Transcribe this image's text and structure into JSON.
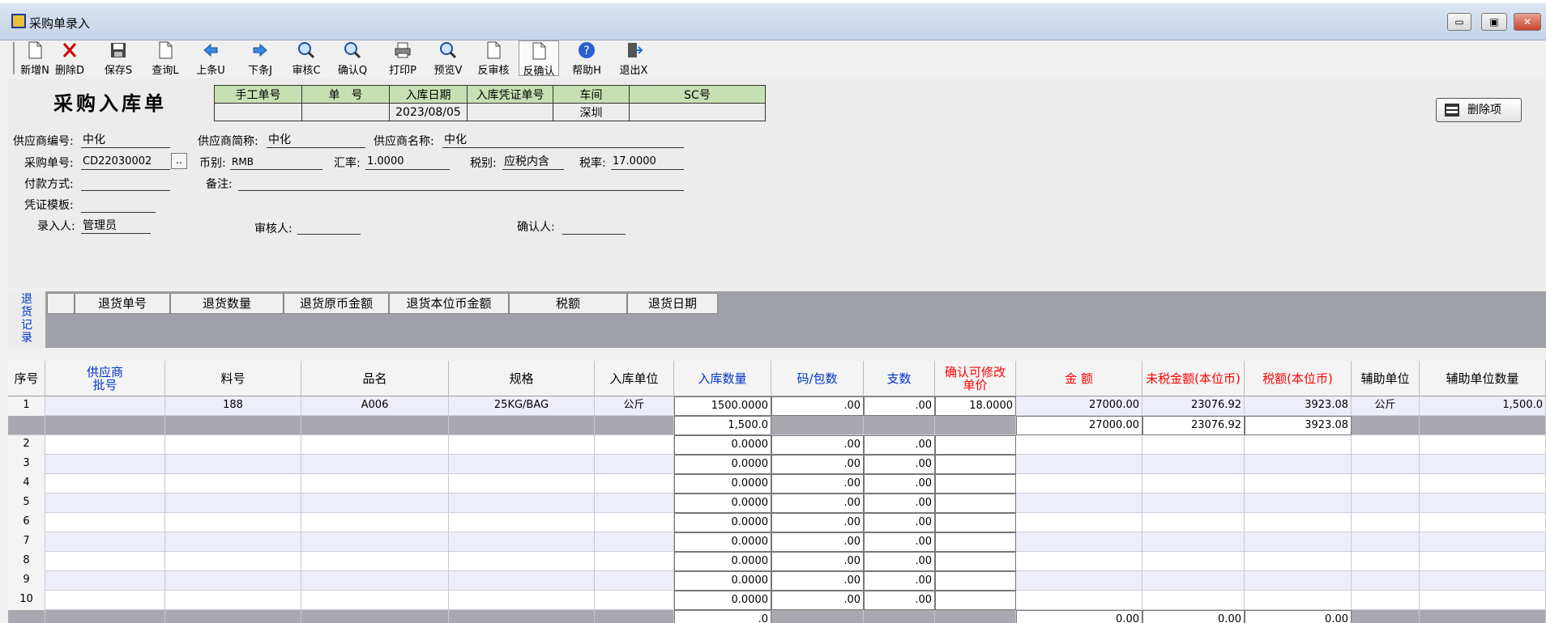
{
  "window": {
    "title": "采购单录入",
    "min": "▭",
    "restore": "▣",
    "close": "✕"
  },
  "toolbar": [
    {
      "label": "新增N",
      "icon": "new-doc-icon"
    },
    {
      "label": "删除D",
      "icon": "delete-x-icon"
    },
    {
      "label": "保存S",
      "icon": "save-disk-icon"
    },
    {
      "label": "查询L",
      "icon": "query-doc-icon"
    },
    {
      "label": "上条U",
      "icon": "arrow-left-icon"
    },
    {
      "label": "下条J",
      "icon": "arrow-right-icon"
    },
    {
      "label": "审核C",
      "icon": "magnifier-icon"
    },
    {
      "label": "确认Q",
      "icon": "magnifier-icon"
    },
    {
      "label": "打印P",
      "icon": "printer-icon"
    },
    {
      "label": "预览V",
      "icon": "preview-magnifier-icon"
    },
    {
      "label": "反审核",
      "icon": "reverse-audit-icon"
    },
    {
      "label": "反确认",
      "icon": "reverse-confirm-icon"
    },
    {
      "label": "帮助H",
      "icon": "help-icon"
    },
    {
      "label": "退出X",
      "icon": "exit-door-icon"
    }
  ],
  "form": {
    "title": "采购入库单",
    "header_cols": [
      "手工单号",
      "单　号",
      "入库日期",
      "入库凭证单号",
      "车间",
      "SC号"
    ],
    "header_vals": [
      "",
      "",
      "2023/08/05",
      "",
      "深圳",
      ""
    ],
    "supplier_code_label": "供应商编号:",
    "supplier_code": "中化",
    "supplier_short_label": "供应商简称:",
    "supplier_short": "中化",
    "supplier_name_label": "供应商名称:",
    "supplier_name": "中化",
    "po_label": "采购单号:",
    "po": "CD22030002",
    "po_btn": "..",
    "currency_label": "币别:",
    "currency": "RMB",
    "rate_label": "汇率:",
    "rate": "1.0000",
    "tax_type_label": "税别:",
    "tax_type": "应税内含",
    "tax_rate_label": "税率:",
    "tax_rate": "17.0000",
    "payment_label": "付款方式:",
    "payment": "",
    "remark_label": "备注:",
    "remark": "",
    "voucher_label": "凭证模板:",
    "voucher": "",
    "entered_by_label": "录入人:",
    "entered_by": "管理员",
    "auditor_label": "审核人:",
    "auditor": "",
    "confirmer_label": "确认人:",
    "confirmer": "",
    "delete_item_btn": "删除项"
  },
  "returns": {
    "side_label": [
      "退",
      "货",
      "记",
      "录"
    ],
    "columns": [
      "退货单号",
      "退货数量",
      "退货原币金额",
      "退货本位币金额",
      "税额",
      "退货日期"
    ]
  },
  "grid": {
    "columns": [
      "序号",
      "供应商\n批号",
      "料号",
      "品名",
      "规格",
      "入库单位",
      "入库数量",
      "码/包数",
      "支数",
      "确认可修改\n单价",
      "金 额",
      "未税金额(本位币)",
      "税额(本位币)",
      "辅助单位",
      "辅助单位数量"
    ],
    "column_colors": [
      "#000000",
      "#0033cc",
      "#000000",
      "#000000",
      "#000000",
      "#000000",
      "#0033cc",
      "#0033cc",
      "#0033cc",
      "#ff0000",
      "#ff0000",
      "#ff0000",
      "#ff0000",
      "#000000",
      "#000000"
    ],
    "row1": {
      "no": "1",
      "batch": "",
      "part": "188",
      "name": "A006",
      "spec": "25KG/BAG",
      "unit": "公斤",
      "qty": "1500.0000",
      "pack": ".00",
      "count": ".00",
      "price": "18.0000",
      "amount": "27000.00",
      "net": "23076.92",
      "tax": "3923.08",
      "aux_unit": "公斤",
      "aux_qty": "1,500.0"
    },
    "sub1": {
      "qty": "1,500.0",
      "amount": "27000.00",
      "net": "23076.92",
      "tax": "3923.08"
    },
    "empty_rows": [
      {
        "no": "2",
        "qty": "0.0000",
        "pack": ".00",
        "count": ".00"
      },
      {
        "no": "3",
        "qty": "0.0000",
        "pack": ".00",
        "count": ".00"
      },
      {
        "no": "4",
        "qty": "0.0000",
        "pack": ".00",
        "count": ".00"
      },
      {
        "no": "5",
        "qty": "0.0000",
        "pack": ".00",
        "count": ".00"
      },
      {
        "no": "6",
        "qty": "0.0000",
        "pack": ".00",
        "count": ".00"
      },
      {
        "no": "7",
        "qty": "0.0000",
        "pack": ".00",
        "count": ".00"
      },
      {
        "no": "8",
        "qty": "0.0000",
        "pack": ".00",
        "count": ".00"
      },
      {
        "no": "9",
        "qty": "0.0000",
        "pack": ".00",
        "count": ".00"
      },
      {
        "no": "10",
        "qty": "0.0000",
        "pack": ".00",
        "count": ".00"
      }
    ],
    "totals": {
      "qty": ".0",
      "amount": "0.00",
      "net": "0.00",
      "tax": "0.00"
    }
  }
}
